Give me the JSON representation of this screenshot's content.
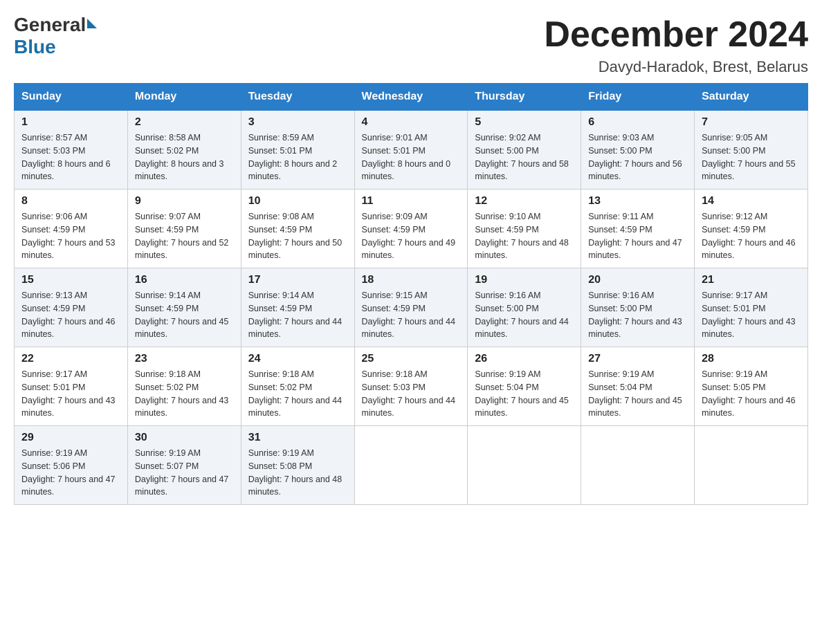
{
  "header": {
    "logo": {
      "general": "General",
      "blue": "Blue"
    },
    "title": "December 2024",
    "location": "Davyd-Haradok, Brest, Belarus"
  },
  "calendar": {
    "days_of_week": [
      "Sunday",
      "Monday",
      "Tuesday",
      "Wednesday",
      "Thursday",
      "Friday",
      "Saturday"
    ],
    "weeks": [
      [
        {
          "day": "1",
          "sunrise": "8:57 AM",
          "sunset": "5:03 PM",
          "daylight": "8 hours and 6 minutes."
        },
        {
          "day": "2",
          "sunrise": "8:58 AM",
          "sunset": "5:02 PM",
          "daylight": "8 hours and 3 minutes."
        },
        {
          "day": "3",
          "sunrise": "8:59 AM",
          "sunset": "5:01 PM",
          "daylight": "8 hours and 2 minutes."
        },
        {
          "day": "4",
          "sunrise": "9:01 AM",
          "sunset": "5:01 PM",
          "daylight": "8 hours and 0 minutes."
        },
        {
          "day": "5",
          "sunrise": "9:02 AM",
          "sunset": "5:00 PM",
          "daylight": "7 hours and 58 minutes."
        },
        {
          "day": "6",
          "sunrise": "9:03 AM",
          "sunset": "5:00 PM",
          "daylight": "7 hours and 56 minutes."
        },
        {
          "day": "7",
          "sunrise": "9:05 AM",
          "sunset": "5:00 PM",
          "daylight": "7 hours and 55 minutes."
        }
      ],
      [
        {
          "day": "8",
          "sunrise": "9:06 AM",
          "sunset": "4:59 PM",
          "daylight": "7 hours and 53 minutes."
        },
        {
          "day": "9",
          "sunrise": "9:07 AM",
          "sunset": "4:59 PM",
          "daylight": "7 hours and 52 minutes."
        },
        {
          "day": "10",
          "sunrise": "9:08 AM",
          "sunset": "4:59 PM",
          "daylight": "7 hours and 50 minutes."
        },
        {
          "day": "11",
          "sunrise": "9:09 AM",
          "sunset": "4:59 PM",
          "daylight": "7 hours and 49 minutes."
        },
        {
          "day": "12",
          "sunrise": "9:10 AM",
          "sunset": "4:59 PM",
          "daylight": "7 hours and 48 minutes."
        },
        {
          "day": "13",
          "sunrise": "9:11 AM",
          "sunset": "4:59 PM",
          "daylight": "7 hours and 47 minutes."
        },
        {
          "day": "14",
          "sunrise": "9:12 AM",
          "sunset": "4:59 PM",
          "daylight": "7 hours and 46 minutes."
        }
      ],
      [
        {
          "day": "15",
          "sunrise": "9:13 AM",
          "sunset": "4:59 PM",
          "daylight": "7 hours and 46 minutes."
        },
        {
          "day": "16",
          "sunrise": "9:14 AM",
          "sunset": "4:59 PM",
          "daylight": "7 hours and 45 minutes."
        },
        {
          "day": "17",
          "sunrise": "9:14 AM",
          "sunset": "4:59 PM",
          "daylight": "7 hours and 44 minutes."
        },
        {
          "day": "18",
          "sunrise": "9:15 AM",
          "sunset": "4:59 PM",
          "daylight": "7 hours and 44 minutes."
        },
        {
          "day": "19",
          "sunrise": "9:16 AM",
          "sunset": "5:00 PM",
          "daylight": "7 hours and 44 minutes."
        },
        {
          "day": "20",
          "sunrise": "9:16 AM",
          "sunset": "5:00 PM",
          "daylight": "7 hours and 43 minutes."
        },
        {
          "day": "21",
          "sunrise": "9:17 AM",
          "sunset": "5:01 PM",
          "daylight": "7 hours and 43 minutes."
        }
      ],
      [
        {
          "day": "22",
          "sunrise": "9:17 AM",
          "sunset": "5:01 PM",
          "daylight": "7 hours and 43 minutes."
        },
        {
          "day": "23",
          "sunrise": "9:18 AM",
          "sunset": "5:02 PM",
          "daylight": "7 hours and 43 minutes."
        },
        {
          "day": "24",
          "sunrise": "9:18 AM",
          "sunset": "5:02 PM",
          "daylight": "7 hours and 44 minutes."
        },
        {
          "day": "25",
          "sunrise": "9:18 AM",
          "sunset": "5:03 PM",
          "daylight": "7 hours and 44 minutes."
        },
        {
          "day": "26",
          "sunrise": "9:19 AM",
          "sunset": "5:04 PM",
          "daylight": "7 hours and 45 minutes."
        },
        {
          "day": "27",
          "sunrise": "9:19 AM",
          "sunset": "5:04 PM",
          "daylight": "7 hours and 45 minutes."
        },
        {
          "day": "28",
          "sunrise": "9:19 AM",
          "sunset": "5:05 PM",
          "daylight": "7 hours and 46 minutes."
        }
      ],
      [
        {
          "day": "29",
          "sunrise": "9:19 AM",
          "sunset": "5:06 PM",
          "daylight": "7 hours and 47 minutes."
        },
        {
          "day": "30",
          "sunrise": "9:19 AM",
          "sunset": "5:07 PM",
          "daylight": "7 hours and 47 minutes."
        },
        {
          "day": "31",
          "sunrise": "9:19 AM",
          "sunset": "5:08 PM",
          "daylight": "7 hours and 48 minutes."
        },
        null,
        null,
        null,
        null
      ]
    ]
  }
}
